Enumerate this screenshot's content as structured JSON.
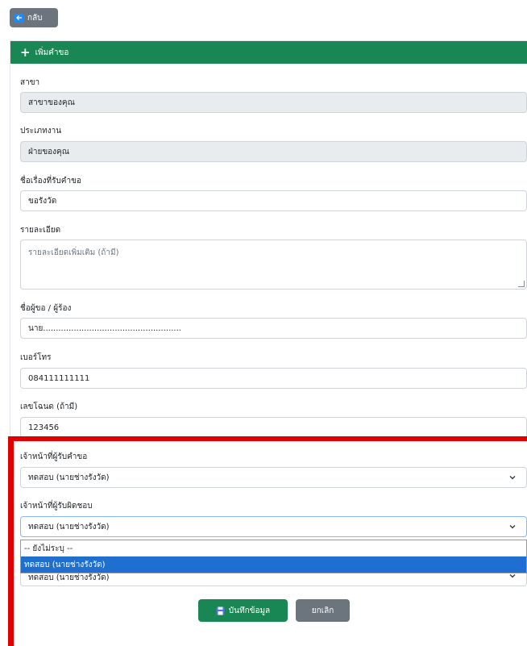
{
  "back_button": {
    "label": "กลับ"
  },
  "card": {
    "title": "เพิ่มคำขอ"
  },
  "form": {
    "branch": {
      "label": "สาขา",
      "value": "สาขาของคุณ"
    },
    "department": {
      "label": "ประเภทงาน",
      "value": "ฝ่ายของคุณ"
    },
    "subject": {
      "label": "ชื่อเรื่องที่รับคำขอ",
      "value": "ขอรังวัด"
    },
    "details": {
      "label": "รายละเอียด",
      "placeholder": "รายละเอียดเพิ่มเติม (ถ้ามี)"
    },
    "requester": {
      "label": "ชื่อผู้ขอ / ผู้ร้อง",
      "value": "นาย......................................................"
    },
    "phone": {
      "label": "เบอร์โทร",
      "value": "084111111111"
    },
    "deed": {
      "label": "เลขโฉนด (ถ้ามี)",
      "value": "123456"
    },
    "receiver_officer": {
      "label": "เจ้าหน้าที่ผู้รับคำขอ",
      "value": "ทดสอบ (นายช่างรังวัด)"
    },
    "responsible_officer": {
      "label": "เจ้าหน้าที่ผู้รับผิดชอบ",
      "value": "ทดสอบ (นายช่างรังวัด)",
      "options": [
        "-- ยังไม่ระบุ --",
        "ทดสอบ (นายช่างรังวัด)"
      ],
      "behind_value": "ทดสอบ (นายช่างรังวัด)"
    }
  },
  "actions": {
    "save_label": "บันทึกข้อมูล",
    "cancel_label": "ยกเลิก"
  },
  "colors": {
    "header": "#198754",
    "highlight": "#e00000",
    "selected_option": "#1f6fd1"
  }
}
